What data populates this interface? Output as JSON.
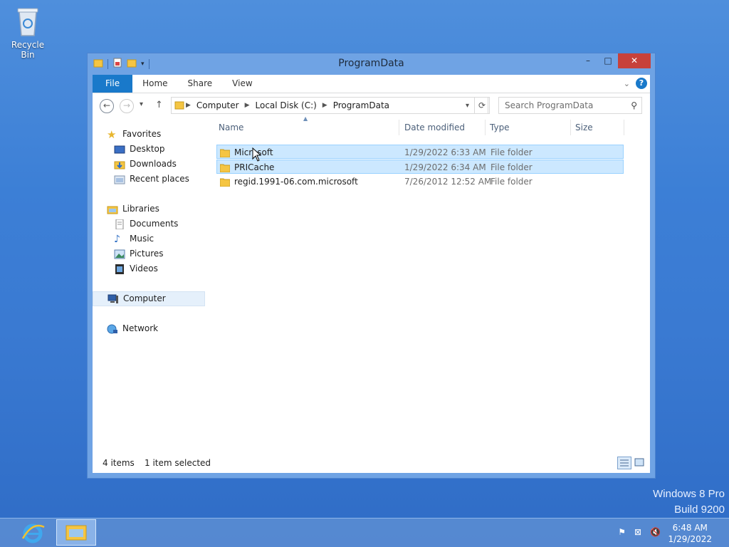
{
  "desktop": {
    "recycle_bin_label": "Recycle Bin",
    "watermark_line1": "Windows 8 Pro",
    "watermark_line2": "Build 9200"
  },
  "window": {
    "title": "ProgramData",
    "controls": {
      "minimize": "–",
      "maximize": "□",
      "close": "✕"
    }
  },
  "ribbon": {
    "tabs": [
      "File",
      "Home",
      "Share",
      "View"
    ]
  },
  "navbar": {
    "back": "←",
    "forward": "→",
    "recent": "▾",
    "up": "↑",
    "breadcrumbs": [
      "Computer",
      "Local Disk (C:)",
      "ProgramData"
    ],
    "search_placeholder": "Search ProgramData"
  },
  "navpane": {
    "favorites": {
      "label": "Favorites",
      "items": [
        "Desktop",
        "Downloads",
        "Recent places"
      ]
    },
    "libraries": {
      "label": "Libraries",
      "items": [
        "Documents",
        "Music",
        "Pictures",
        "Videos"
      ]
    },
    "computer": "Computer",
    "network": "Network"
  },
  "columns": [
    "Name",
    "Date modified",
    "Type",
    "Size"
  ],
  "files": [
    {
      "name": "Microsoft",
      "date": "1/29/2022 6:33 AM",
      "type": "File folder",
      "size": "",
      "selected": true
    },
    {
      "name": "PRICache",
      "date": "1/29/2022 6:34 AM",
      "type": "File folder",
      "size": "",
      "selected": true
    },
    {
      "name": "regid.1991-06.com.microsoft",
      "date": "7/26/2012 12:52 AM",
      "type": "File folder",
      "size": "",
      "selected": false
    }
  ],
  "status": {
    "count": "4 items",
    "selected": "1 item selected"
  },
  "clock": {
    "time": "6:48 AM",
    "date": "1/29/2022"
  },
  "colors": {
    "accent": "#1979ca",
    "selection": "#cce8ff",
    "desktop": "#3c7fd6"
  }
}
